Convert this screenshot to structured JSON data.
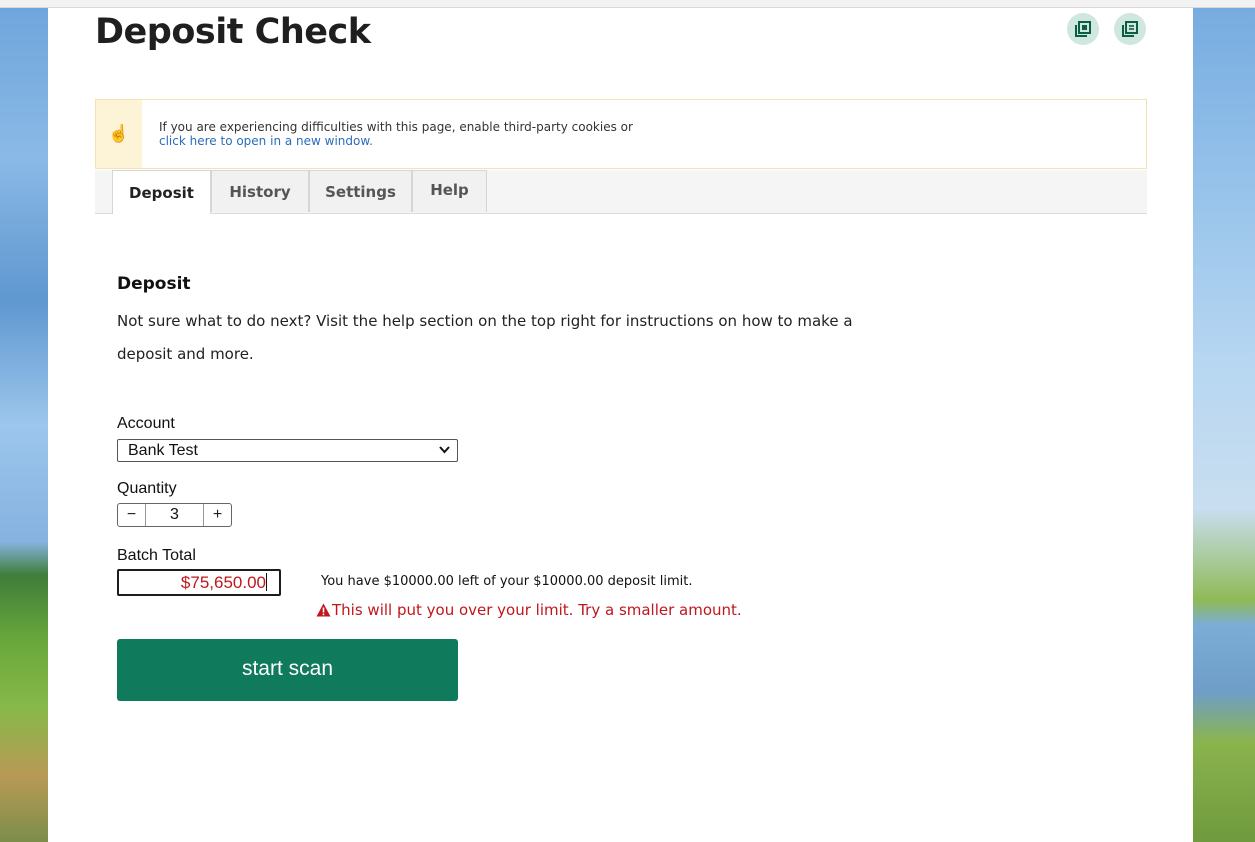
{
  "page": {
    "title": "Deposit Check"
  },
  "header_actions": [
    {
      "icon": "popout-icon"
    },
    {
      "icon": "document-list-icon"
    }
  ],
  "notice": {
    "icon": "hand-pointer-icon",
    "message": "If you are experiencing difficulties with this page, enable third-party cookies or",
    "link_text": "click here to open in a new window."
  },
  "tabs": [
    {
      "label": "Deposit",
      "active": true
    },
    {
      "label": "History",
      "active": false
    },
    {
      "label": "Settings",
      "active": false
    },
    {
      "label": "Help",
      "active": false
    }
  ],
  "deposit": {
    "section_title": "Deposit",
    "description": "Not sure what to do next? Visit the help section on the top right for instructions on how to make a deposit and more.",
    "account": {
      "label": "Account",
      "selected": "Bank Test"
    },
    "quantity": {
      "label": "Quantity",
      "value": "3",
      "minus": "−",
      "plus": "+"
    },
    "batch_total": {
      "label": "Batch Total",
      "value": "$75,650.00"
    },
    "limit_text": "You have $10000.00 left of your $10000.00 deposit limit.",
    "warning_text": "This will put you over your limit. Try a smaller amount.",
    "scan_button": "start scan"
  },
  "colors": {
    "accent": "#0f7a5c",
    "error": "#c0161c",
    "link": "#2a6ebb"
  }
}
